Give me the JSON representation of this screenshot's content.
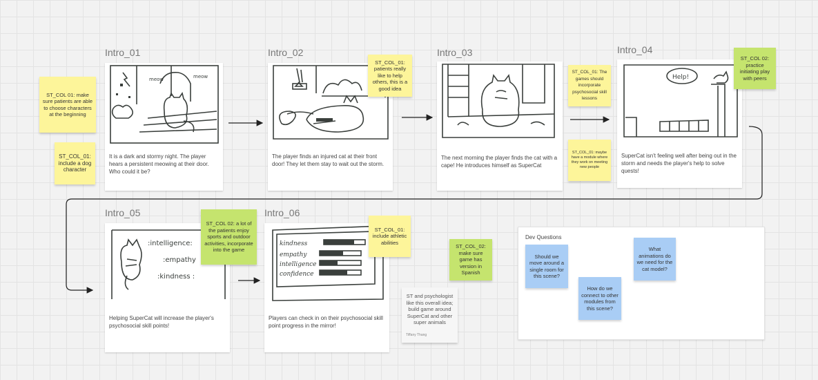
{
  "frames": [
    {
      "title": "Intro_01",
      "caption": "It is a dark and stormy night. The player hears a persistent meowing at their door. Who could it be?"
    },
    {
      "title": "Intro_02",
      "caption": "The player finds an injured cat at their front door! They let them stay to wait out the storm."
    },
    {
      "title": "Intro_03",
      "caption": "The next morning the player finds the cat with a cape! He introduces himself as SuperCat"
    },
    {
      "title": "Intro_04",
      "caption": "SuperCat isn't feeling well after being out in the storm and needs the player's help to solve quests!"
    },
    {
      "title": "Intro_05",
      "caption": "Helping SuperCat will increase the player's psychosocial skill points!"
    },
    {
      "title": "Intro_06",
      "caption": "Players can check in on their psychosocial skill point progress in the mirror!"
    }
  ],
  "sketch_text": {
    "meow1": "meow",
    "meow2": "meow",
    "help": "Help!",
    "stat1": "intelligence",
    "stat2": "empathy",
    "stat3": "kindness",
    "mirror1": "kindness",
    "mirror2": "empathy",
    "mirror3": "intelligence",
    "mirror4": "confidence"
  },
  "stickies": {
    "s1": "ST_COL 01: make sure patients are able to choose characters at the beginning",
    "s2": "ST_COL_01: include a dog character",
    "s3": "ST_COL_01: patients really like to help others, this is a good idea",
    "s4": "ST_COL_01: The games should incorporate psychosocial skill lessons",
    "s5": "ST_COL_01: maybe have a module where they work on meeting new people",
    "s6": "ST_COL 02: practice initiating play with peers",
    "s7": "ST_COL 02: a lot of the patients enjoy sports and outdoor activities, incorporate into the game",
    "s8": "ST_COL_01: include athletic abilities",
    "s9": "ST_COL_02: make sure game has version in Spanish",
    "s10": "ST and psychologist like this overall idea; build game around SuperCat and other super animals",
    "s10_author": "Tiffany Thang"
  },
  "dev_questions": {
    "title": "Dev Questions",
    "q1": "Should we move around a single room for this scene?",
    "q2": "How do we connect to other modules from this scene?",
    "q3": "What animations do we need for the cat model?"
  },
  "colors": {
    "yellow": "#fdf59a",
    "green": "#c5e46e",
    "blue": "#a9cdf5",
    "ink": "#3a3f3c"
  }
}
